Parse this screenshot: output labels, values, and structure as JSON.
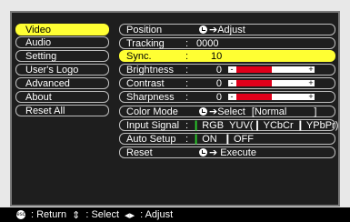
{
  "menu": {
    "items": [
      {
        "label": "Video",
        "selected": true
      },
      {
        "label": "Audio",
        "selected": false
      },
      {
        "label": "Setting",
        "selected": false
      },
      {
        "label": "User's Logo",
        "selected": false
      },
      {
        "label": "Advanced",
        "selected": false
      },
      {
        "label": "About",
        "selected": false
      },
      {
        "label": "Reset All",
        "selected": false
      }
    ]
  },
  "settings": {
    "position": {
      "label": "Position",
      "value": "Adjust"
    },
    "tracking": {
      "label": "Tracking",
      "value": "0000"
    },
    "sync": {
      "label": "Sync.",
      "value": "10"
    },
    "brightness": {
      "label": "Brightness",
      "value": "0",
      "level_fraction": 0.5
    },
    "contrast": {
      "label": "Contrast",
      "value": "0",
      "level_fraction": 0.5
    },
    "sharpness": {
      "label": "Sharpness",
      "value": "0",
      "level_fraction": 0.5
    },
    "color_mode": {
      "label": "Color Mode",
      "action": "Select",
      "value": "[Normal"
    },
    "input_signal": {
      "label": "Input Signal",
      "options": [
        "RGB",
        "YUV(",
        "YCbCr",
        "YPbPr)"
      ],
      "selected": "RGB"
    },
    "auto_setup": {
      "label": "Auto Setup",
      "options": [
        "ON",
        "OFF"
      ],
      "selected": "ON"
    },
    "reset": {
      "label": "Reset",
      "value": "Execute"
    }
  },
  "footer": {
    "return_label": ": Return",
    "select_label": ": Select",
    "adjust_label": ": Adjust",
    "esc_icon_text": "esc"
  },
  "colors": {
    "highlight": "#ffff33",
    "panel_bg": "#1e1e1e",
    "bar_fill": "#e0001b",
    "radio_on": "#2bd02b"
  }
}
